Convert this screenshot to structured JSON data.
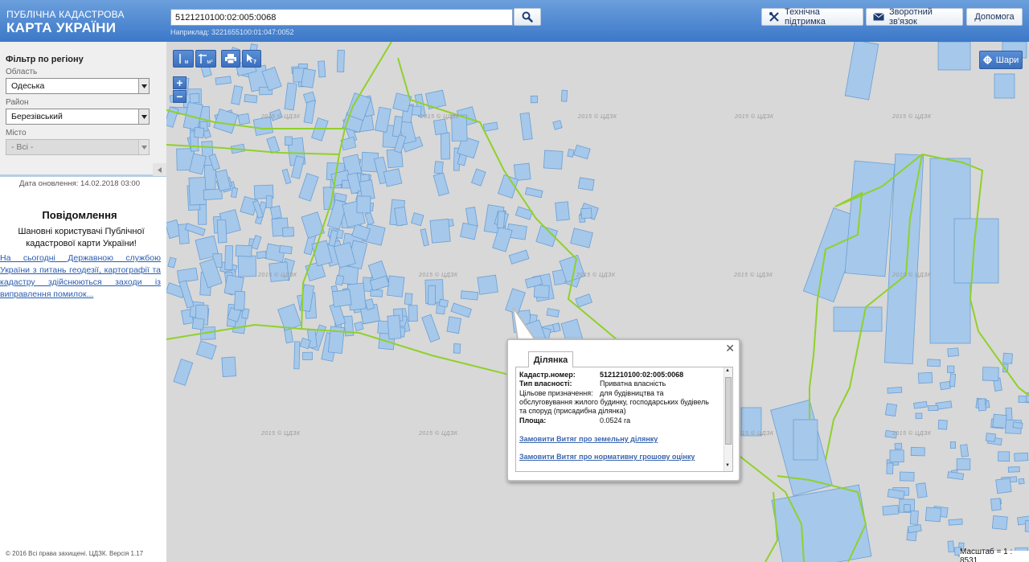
{
  "header": {
    "logo_line1": "ПУБЛІЧНА КАДАСТРОВА",
    "logo_line2": "КАРТА УКРАЇНИ",
    "search_value": "5121210100:02:005:0068",
    "search_hint": "Наприклад: 3221655100:01:047:0052",
    "buttons": {
      "support": "Технічна підтримка",
      "feedback": "Зворотний зв'язок",
      "help": "Допомога"
    }
  },
  "sidebar": {
    "filter_title": "Фільтр по регіону",
    "oblast_label": "Область",
    "oblast_value": "Одеська",
    "rayon_label": "Район",
    "rayon_value": "Березівський",
    "city_label": "Місто",
    "city_value": "- Всі -",
    "update_date": "Дата оновлення: 14.02.2018 03:00",
    "message_title": "Повідомлення",
    "message_body": "Шановні користувачі Публічної кадастрової карти України!",
    "message_link": "На сьогодні Державною службою України з питань геодезії, картографії та кадастру здійснюються заходи із виправлення помилок...",
    "copyright": "© 2016 Всі права захищені. ЦДЗК. Версія 1.17"
  },
  "map": {
    "tools": {
      "measure_m": "м",
      "measure_m2": "м²"
    },
    "layers_label": "Шари",
    "scale": "Масштаб = 1 : 8531",
    "watermark": "2015 © ЦДЗК",
    "colors": {
      "parcel_fill": "#a6c8ea",
      "parcel_stroke": "#6a9fd4",
      "boundary": "#8fd12a"
    }
  },
  "popup": {
    "tab": "Ділянка",
    "rows": [
      {
        "key": "Кадастр.номер:",
        "value": "5121210100:02:005:0068"
      },
      {
        "key": "Тип власності:",
        "value": "Приватна власність"
      },
      {
        "key": "Цільове призначення:",
        "value": "для будівництва та"
      }
    ],
    "purpose_cont_1": "обслуговування жилого будинку, господарських будівель",
    "purpose_cont_2": "та споруд (присадибна ділянка)",
    "area_key": "Площа:",
    "area_value": "0.0524 га",
    "link1": "Замовити Витяг про земельну ділянку",
    "link2": "Замовити Витяг про нормативну грошову оцінку"
  }
}
